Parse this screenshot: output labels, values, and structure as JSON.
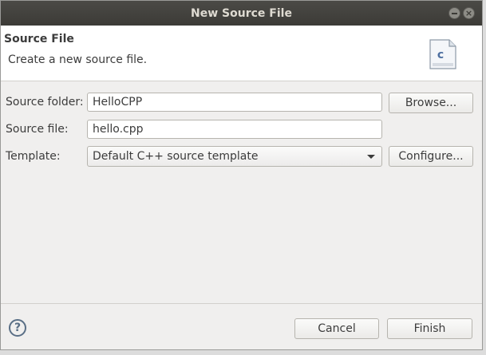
{
  "window": {
    "title": "New Source File"
  },
  "banner": {
    "title": "Source File",
    "description": "Create a new source file.",
    "icon_letter": "c"
  },
  "form": {
    "source_folder": {
      "label": "Source folder:",
      "value": "HelloCPP",
      "button": "Browse..."
    },
    "source_file": {
      "label": "Source file:",
      "value": "hello.cpp"
    },
    "template": {
      "label": "Template:",
      "value": "Default C++ source template",
      "button": "Configure..."
    }
  },
  "footer": {
    "help_glyph": "?",
    "cancel": "Cancel",
    "finish": "Finish"
  },
  "icons": {
    "help": "help-icon",
    "file": "c-source-file-icon",
    "minimize": "minimize-icon",
    "close": "close-icon"
  }
}
